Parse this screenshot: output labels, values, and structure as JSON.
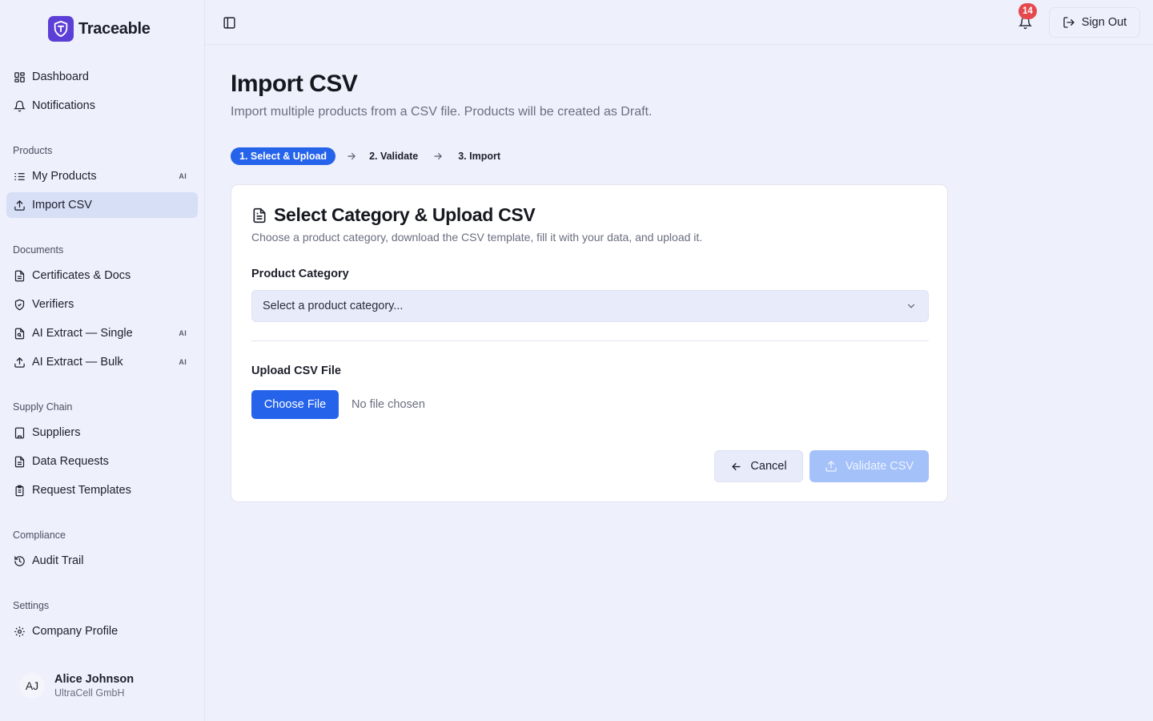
{
  "brand": {
    "name": "Traceable",
    "accent": "#5b3fd6"
  },
  "nav": {
    "top": [
      {
        "label": "Dashboard",
        "icon": "dashboard-grid-icon"
      },
      {
        "label": "Notifications",
        "icon": "bell-icon"
      }
    ],
    "sections": {
      "products": "Products",
      "documents": "Documents",
      "supply_chain": "Supply Chain",
      "compliance": "Compliance",
      "settings": "Settings"
    },
    "products": [
      {
        "label": "My Products",
        "badge": "AI"
      },
      {
        "label": "Import CSV",
        "active": true
      }
    ],
    "documents": [
      {
        "label": "Certificates & Docs"
      },
      {
        "label": "Verifiers"
      },
      {
        "label": "AI Extract — Single",
        "badge": "AI"
      },
      {
        "label": "AI Extract — Bulk",
        "badge": "AI"
      }
    ],
    "supply_chain": [
      {
        "label": "Suppliers"
      },
      {
        "label": "Data Requests"
      },
      {
        "label": "Request Templates"
      }
    ],
    "compliance": [
      {
        "label": "Audit Trail"
      }
    ],
    "settings": [
      {
        "label": "Company Profile"
      }
    ]
  },
  "user": {
    "initials": "AJ",
    "name": "Alice Johnson",
    "org": "UltraCell GmbH"
  },
  "topbar": {
    "notification_count": "14",
    "sign_out": "Sign Out"
  },
  "page": {
    "title": "Import CSV",
    "subtitle": "Import multiple products from a CSV file. Products will be created as Draft."
  },
  "steps": [
    "1. Select & Upload",
    "2. Validate",
    "3. Import"
  ],
  "card": {
    "title": "Select Category & Upload CSV",
    "description": "Choose a product category, download the CSV template, fill it with your data, and upload it.",
    "category_label": "Product Category",
    "category_placeholder": "Select a product category...",
    "upload_label": "Upload CSV File",
    "choose_file": "Choose File",
    "file_status": "No file chosen",
    "cancel": "Cancel",
    "validate": "Validate CSV"
  },
  "colors": {
    "primary": "#2563eb",
    "primary_disabled": "#a4c1f9",
    "badge": "#e5484d",
    "active_nav": "#d7dff6"
  }
}
